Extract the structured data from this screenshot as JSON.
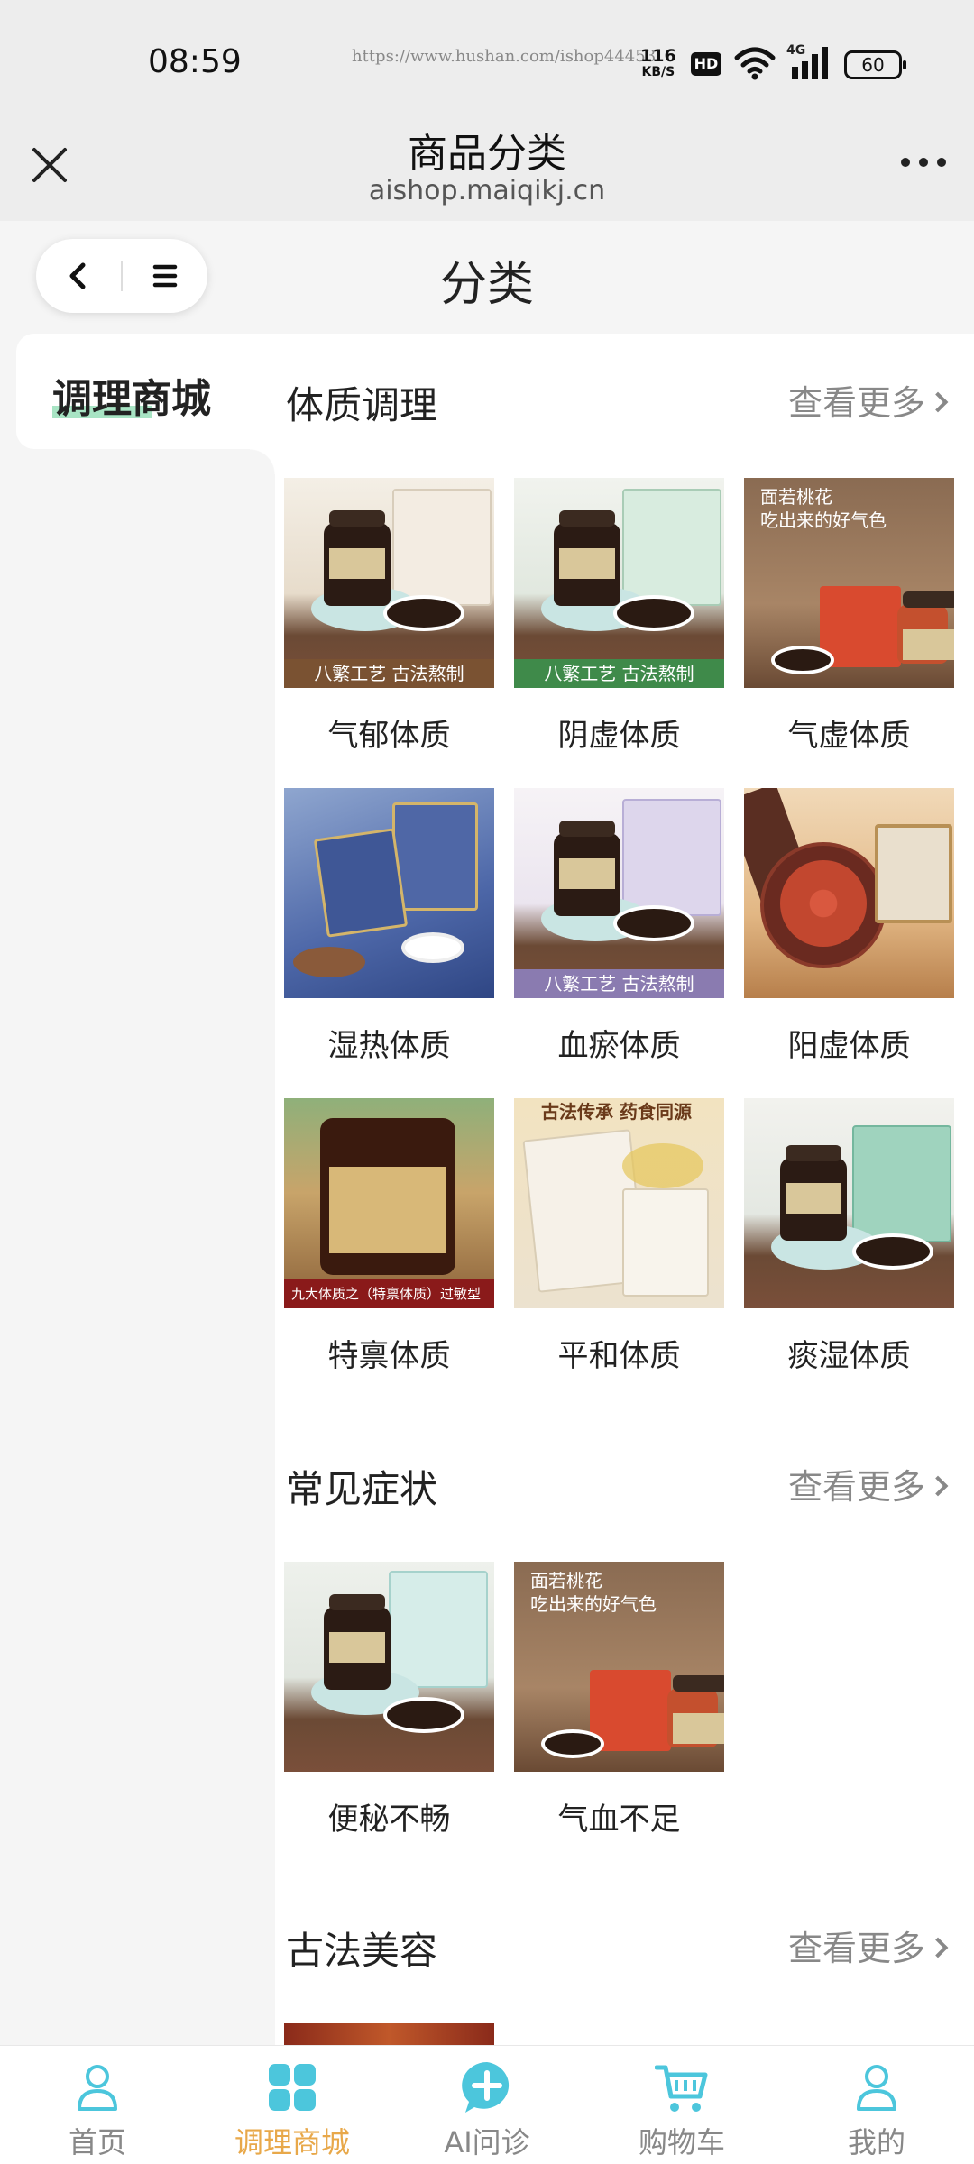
{
  "status_bar": {
    "time": "08:59",
    "url": "https://www.hushan.com/ishop44453",
    "net_speed_value": "116",
    "net_speed_unit": "KB/S",
    "hd": "HD",
    "network": "4G",
    "battery": "60"
  },
  "titlebar": {
    "title": "商品分类",
    "domain": "aishop.maiqikj.cn"
  },
  "header": {
    "title": "分类"
  },
  "sidebar": {
    "items": [
      {
        "label": "调理商城",
        "active": true
      }
    ]
  },
  "sections": [
    {
      "title": "体质调理",
      "more": "查看更多",
      "items": [
        {
          "label": "气郁体质",
          "caption": "八繁工艺  古法熬制"
        },
        {
          "label": "阴虚体质",
          "caption": "八繁工艺  古法熬制"
        },
        {
          "label": "气虚体质",
          "text1": "面若桃花",
          "text2": "吃出来的好气色"
        },
        {
          "label": "湿热体质"
        },
        {
          "label": "血瘀体质",
          "caption": "八繁工艺  古法熬制"
        },
        {
          "label": "阳虚体质"
        },
        {
          "label": "特禀体质",
          "caption": "九大体质之（特禀体质）过敏型"
        },
        {
          "label": "平和体质",
          "text1": "古法传承 药食同源"
        },
        {
          "label": "痰湿体质"
        }
      ]
    },
    {
      "title": "常见症状",
      "more": "查看更多",
      "items": [
        {
          "label": "便秘不畅"
        },
        {
          "label": "气血不足",
          "text1": "面若桃花",
          "text2": "吃出来的好气色"
        }
      ]
    },
    {
      "title": "古法美容",
      "more": "查看更多",
      "items": []
    }
  ],
  "bottom_nav": [
    {
      "label": "首页",
      "icon": "person-icon",
      "active": false
    },
    {
      "label": "调理商城",
      "icon": "grid-icon",
      "active": true
    },
    {
      "label": "AI问诊",
      "icon": "chat-plus-icon",
      "active": false
    },
    {
      "label": "购物车",
      "icon": "cart-icon",
      "active": false
    },
    {
      "label": "我的",
      "icon": "person-icon",
      "active": false
    }
  ],
  "colors": {
    "accent": "#e8a84a",
    "icon_teal": "#4cc6dc",
    "sidebar_bg": "#f5f5f5",
    "highlight": "#a8e4c4"
  }
}
